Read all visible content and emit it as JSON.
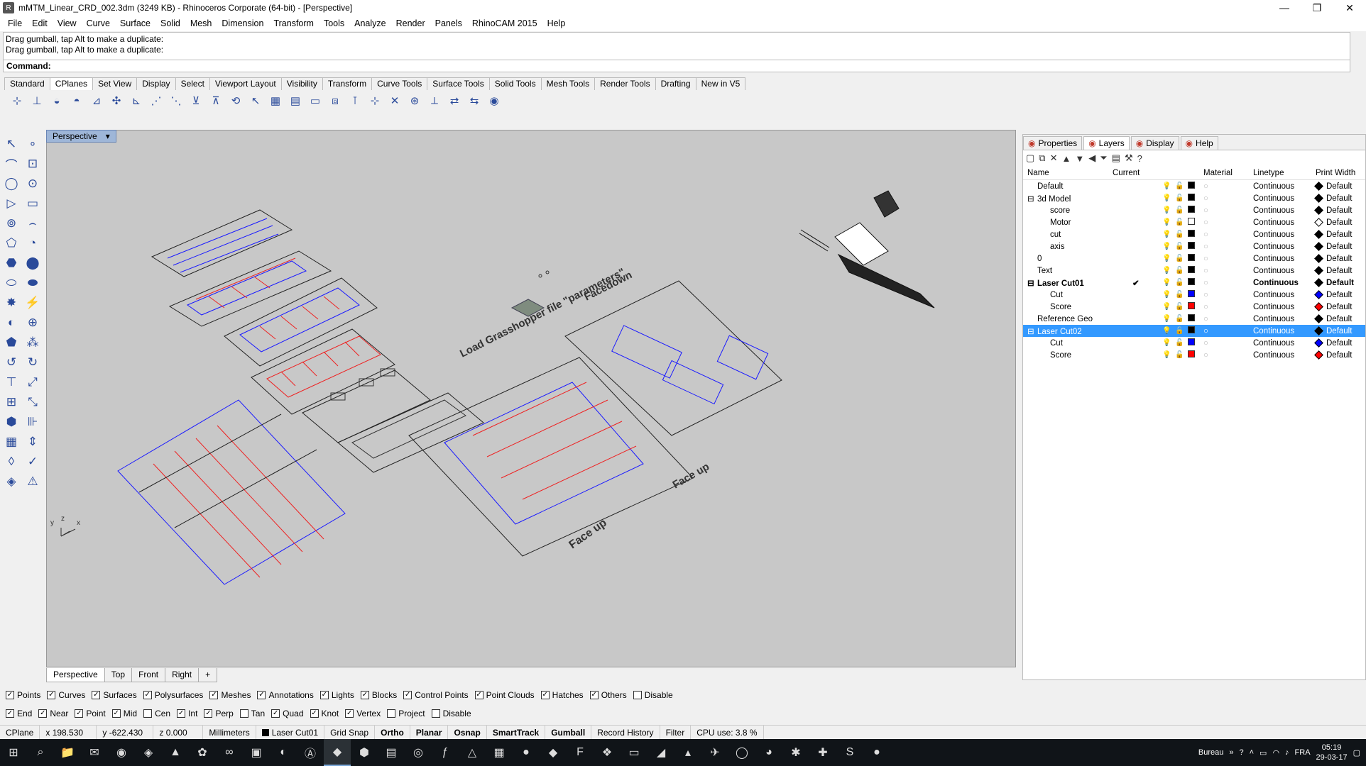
{
  "window": {
    "title": "mMTM_Linear_CRD_002.3dm (3249 KB) - Rhinoceros Corporate (64-bit) - [Perspective]",
    "minimize": "—",
    "restore": "❐",
    "close": "✕"
  },
  "menu": [
    "File",
    "Edit",
    "View",
    "Curve",
    "Surface",
    "Solid",
    "Mesh",
    "Dimension",
    "Transform",
    "Tools",
    "Analyze",
    "Render",
    "Panels",
    "RhinoCAM 2015",
    "Help"
  ],
  "command": {
    "history": [
      "Drag gumball, tap Alt to make a duplicate:",
      "Drag gumball, tap Alt to make a duplicate:"
    ],
    "prompt": "Command:"
  },
  "toolbar_tabs": [
    "Standard",
    "CPlanes",
    "Set View",
    "Display",
    "Select",
    "Viewport Layout",
    "Visibility",
    "Transform",
    "Curve Tools",
    "Surface Tools",
    "Solid Tools",
    "Mesh Tools",
    "Render Tools",
    "Drafting",
    "New in V5"
  ],
  "toolbar_tab_selected": "CPlanes",
  "viewport": {
    "label": "Perspective",
    "annotations": {
      "grasshopper": "Load Grasshopper file \"parameters\"",
      "facedown": "Facedown",
      "faceup1": "Face up",
      "faceup2": "Face up"
    },
    "axes": {
      "x": "x",
      "y": "y",
      "z": "z"
    },
    "tabs": [
      "Perspective",
      "Top",
      "Front",
      "Right",
      "+"
    ]
  },
  "panel": {
    "tabs": [
      {
        "label": "Properties",
        "icon": "properties-icon"
      },
      {
        "label": "Layers",
        "icon": "layers-icon"
      },
      {
        "label": "Display",
        "icon": "display-icon"
      },
      {
        "label": "Help",
        "icon": "help-icon"
      }
    ],
    "selected_tab": "Layers",
    "columns": [
      "Name",
      "Current",
      "",
      "",
      "",
      "Material",
      "Linetype",
      "Print Width"
    ],
    "layers": [
      {
        "name": "Default",
        "current": "",
        "color": "#000000",
        "linetype": "Continuous",
        "pw": "Default",
        "indent": 0,
        "expander": "",
        "bold": false,
        "selected": false
      },
      {
        "name": "3d Model",
        "current": "",
        "color": "#000000",
        "linetype": "Continuous",
        "pw": "Default",
        "indent": 0,
        "expander": "⊟",
        "bold": false,
        "selected": false
      },
      {
        "name": "score",
        "current": "",
        "color": "#000000",
        "linetype": "Continuous",
        "pw": "Default",
        "indent": 1,
        "expander": "",
        "bold": false,
        "selected": false
      },
      {
        "name": "Motor",
        "current": "",
        "color": "#ffffff",
        "linetype": "Continuous",
        "pw": "Default",
        "indent": 1,
        "expander": "",
        "bold": false,
        "selected": false
      },
      {
        "name": "cut",
        "current": "",
        "color": "#000000",
        "linetype": "Continuous",
        "pw": "Default",
        "indent": 1,
        "expander": "",
        "bold": false,
        "selected": false
      },
      {
        "name": "axis",
        "current": "",
        "color": "#000000",
        "linetype": "Continuous",
        "pw": "Default",
        "indent": 1,
        "expander": "",
        "bold": false,
        "selected": false
      },
      {
        "name": "0",
        "current": "",
        "color": "#000000",
        "linetype": "Continuous",
        "pw": "Default",
        "indent": 0,
        "expander": "",
        "bold": false,
        "selected": false
      },
      {
        "name": "Text",
        "current": "",
        "color": "#000000",
        "linetype": "Continuous",
        "pw": "Default",
        "indent": 0,
        "expander": "",
        "bold": false,
        "selected": false
      },
      {
        "name": "Laser Cut01",
        "current": "✔",
        "color": "#000000",
        "linetype": "Continuous",
        "pw": "Default",
        "indent": 0,
        "expander": "⊟",
        "bold": true,
        "selected": false
      },
      {
        "name": "Cut",
        "current": "",
        "color": "#0000ff",
        "linetype": "Continuous",
        "pw": "Default",
        "indent": 1,
        "expander": "",
        "bold": false,
        "selected": false
      },
      {
        "name": "Score",
        "current": "",
        "color": "#ff0000",
        "linetype": "Continuous",
        "pw": "Default",
        "indent": 1,
        "expander": "",
        "bold": false,
        "selected": false
      },
      {
        "name": "Reference Geo",
        "current": "",
        "color": "#000000",
        "linetype": "Continuous",
        "pw": "Default",
        "indent": 0,
        "expander": "",
        "bold": false,
        "selected": false
      },
      {
        "name": "Laser Cut02",
        "current": "",
        "color": "#000000",
        "linetype": "Continuous",
        "pw": "Default",
        "indent": 0,
        "expander": "⊟",
        "bold": false,
        "selected": true
      },
      {
        "name": "Cut",
        "current": "",
        "color": "#0000ff",
        "linetype": "Continuous",
        "pw": "Default",
        "indent": 1,
        "expander": "",
        "bold": false,
        "selected": false
      },
      {
        "name": "Score",
        "current": "",
        "color": "#ff0000",
        "linetype": "Continuous",
        "pw": "Default",
        "indent": 1,
        "expander": "",
        "bold": false,
        "selected": false
      }
    ]
  },
  "select_filters": [
    {
      "label": "Points",
      "checked": true
    },
    {
      "label": "Curves",
      "checked": true
    },
    {
      "label": "Surfaces",
      "checked": true
    },
    {
      "label": "Polysurfaces",
      "checked": true
    },
    {
      "label": "Meshes",
      "checked": true
    },
    {
      "label": "Annotations",
      "checked": true
    },
    {
      "label": "Lights",
      "checked": true
    },
    {
      "label": "Blocks",
      "checked": true
    },
    {
      "label": "Control Points",
      "checked": true
    },
    {
      "label": "Point Clouds",
      "checked": true
    },
    {
      "label": "Hatches",
      "checked": true
    },
    {
      "label": "Others",
      "checked": true
    },
    {
      "label": "Disable",
      "checked": false
    }
  ],
  "osnaps": [
    {
      "label": "End",
      "checked": true
    },
    {
      "label": "Near",
      "checked": true
    },
    {
      "label": "Point",
      "checked": true
    },
    {
      "label": "Mid",
      "checked": true
    },
    {
      "label": "Cen",
      "checked": false
    },
    {
      "label": "Int",
      "checked": true
    },
    {
      "label": "Perp",
      "checked": true
    },
    {
      "label": "Tan",
      "checked": false
    },
    {
      "label": "Quad",
      "checked": true
    },
    {
      "label": "Knot",
      "checked": true
    },
    {
      "label": "Vertex",
      "checked": true
    },
    {
      "label": "Project",
      "checked": false
    },
    {
      "label": "Disable",
      "checked": false
    }
  ],
  "status": {
    "cplane": "CPlane",
    "x": "x 198.530",
    "y": "y -622.430",
    "z": "z 0.000",
    "units": "Millimeters",
    "layer": "Laser Cut01",
    "gridsnap": "Grid Snap",
    "ortho": "Ortho",
    "planar": "Planar",
    "osnap": "Osnap",
    "smarttrack": "SmartTrack",
    "gumball": "Gumball",
    "record": "Record History",
    "filter": "Filter",
    "cpu": "CPU use: 3.8 %"
  },
  "taskbar": {
    "desktop": "Bureau",
    "lang": "FRA",
    "time": "05:19",
    "date": "29-03-17",
    "chevron": "»"
  },
  "colors": {
    "accent": "#3399ff",
    "viewport_bg": "#c8c8c8",
    "cut": "#0000ff",
    "score": "#ff0000"
  }
}
